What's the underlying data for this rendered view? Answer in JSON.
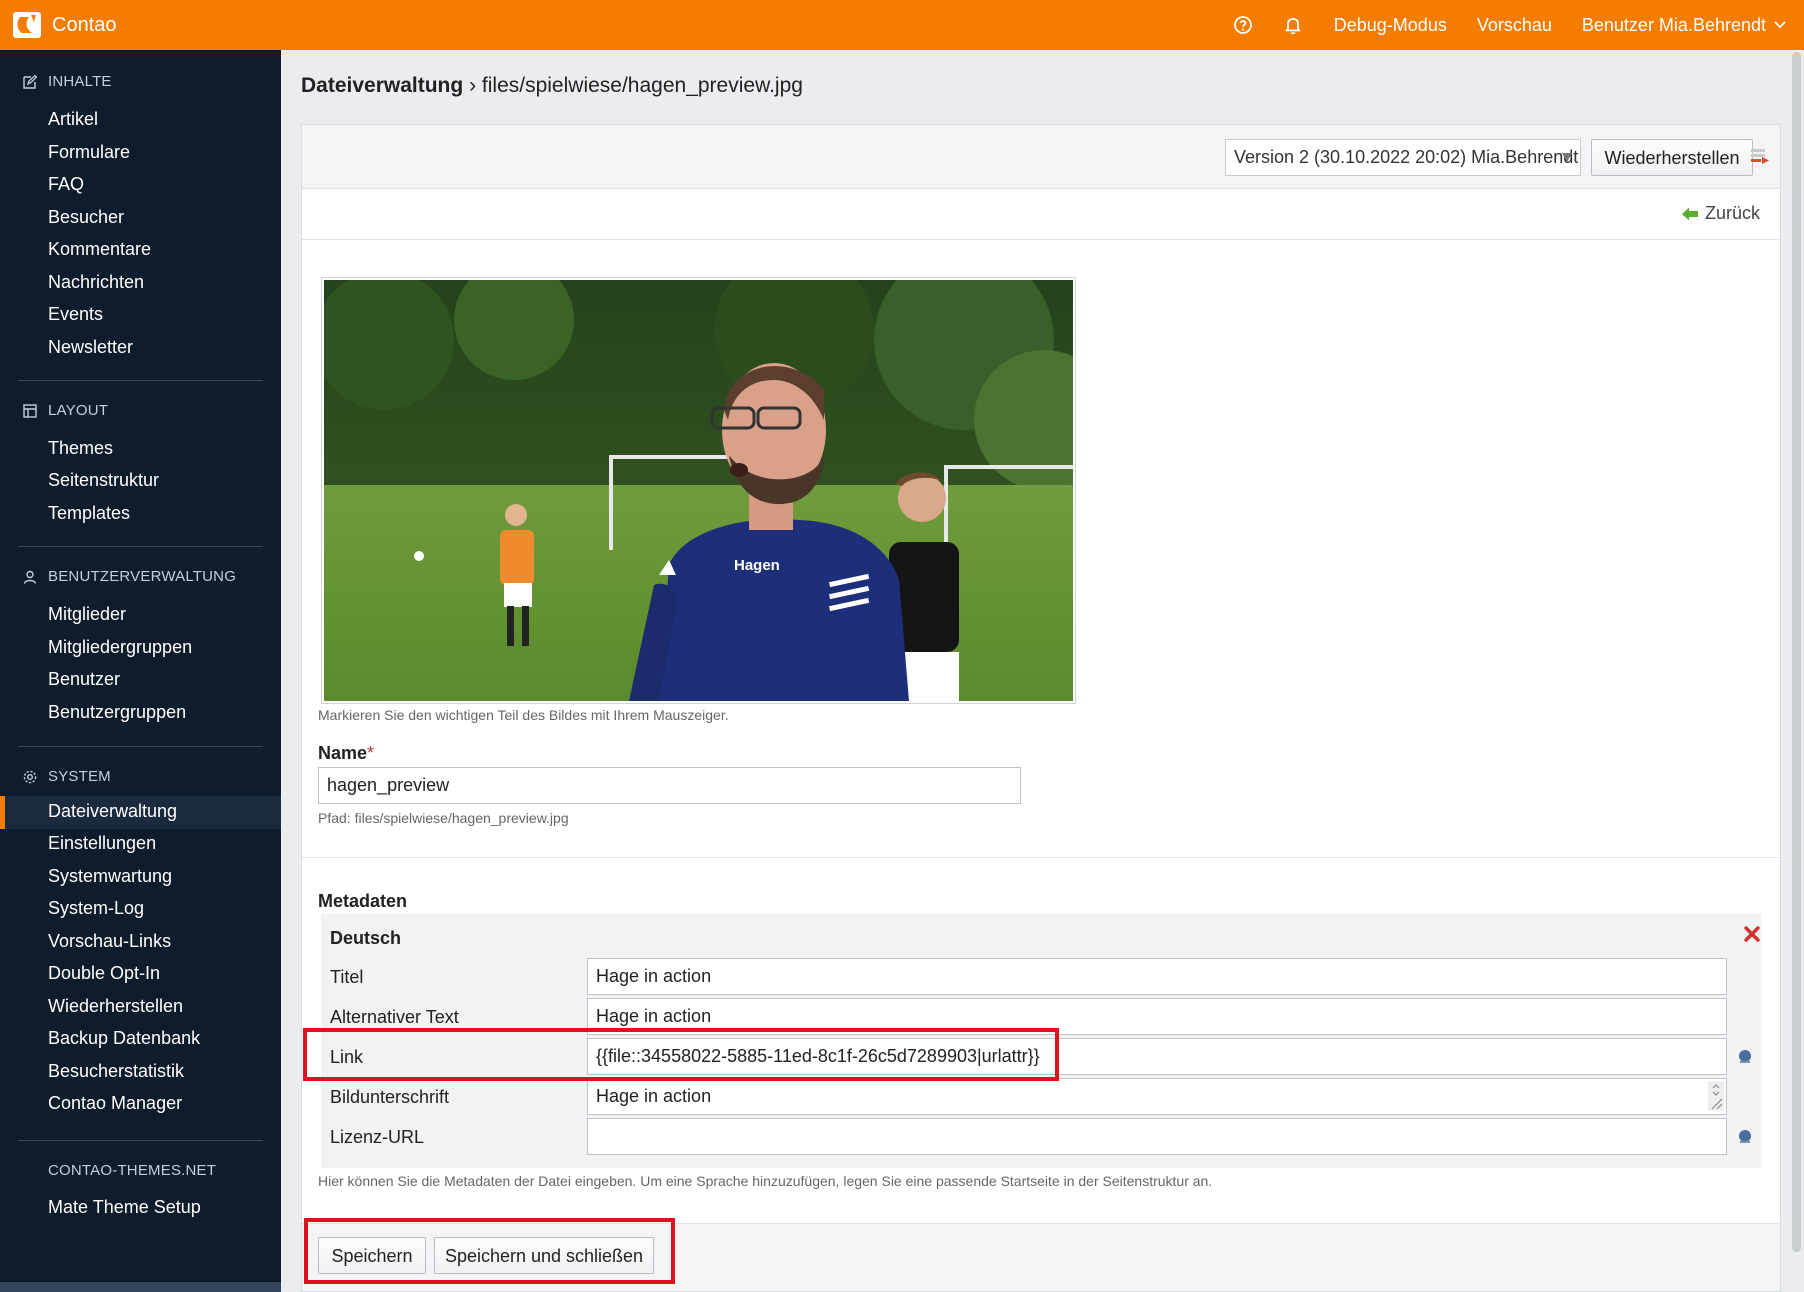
{
  "header": {
    "brand": "Contao",
    "debug": "Debug-Modus",
    "preview": "Vorschau",
    "user": "Benutzer Mia.Behrendt"
  },
  "sidebar": {
    "groups": [
      {
        "title": "INHALTE",
        "items": [
          "Artikel",
          "Formulare",
          "FAQ",
          "Besucher",
          "Kommentare",
          "Nachrichten",
          "Events",
          "Newsletter"
        ]
      },
      {
        "title": "LAYOUT",
        "items": [
          "Themes",
          "Seitenstruktur",
          "Templates"
        ]
      },
      {
        "title": "BENUTZERVERWALTUNG",
        "items": [
          "Mitglieder",
          "Mitgliedergruppen",
          "Benutzer",
          "Benutzergruppen"
        ]
      },
      {
        "title": "SYSTEM",
        "items": [
          "Dateiverwaltung",
          "Einstellungen",
          "Systemwartung",
          "System-Log",
          "Vorschau-Links",
          "Double Opt-In",
          "Wiederherstellen",
          "Backup Datenbank",
          "Besucherstatistik",
          "Contao Manager"
        ]
      },
      {
        "title": "CONTAO-THEMES.NET",
        "items": [
          "Mate Theme Setup"
        ]
      }
    ],
    "active_item": "Dateiverwaltung"
  },
  "breadcrumb": {
    "section": "Dateiverwaltung",
    "separator": "›",
    "path": "files/spielwiese/hagen_preview.jpg"
  },
  "version": {
    "selected": "Version 2 (30.10.2022 20:02) Mia.Behrendt",
    "restore_button": "Wiederherstellen"
  },
  "back_link": "Zurück",
  "image": {
    "shirt_text": "Hagen",
    "hint": "Markieren Sie den wichtigen Teil des Bildes mit Ihrem Mauszeiger."
  },
  "name_field": {
    "label": "Name",
    "required_mark": "*",
    "value": "hagen_preview",
    "path_hint": "Pfad: files/spielwiese/hagen_preview.jpg"
  },
  "metadata": {
    "heading": "Metadaten",
    "language": "Deutsch",
    "fields": {
      "title": {
        "label": "Titel",
        "value": "Hage in action"
      },
      "alt": {
        "label": "Alternativer Text",
        "value": "Hage in action"
      },
      "link": {
        "label": "Link",
        "value": "{{file::34558022-5885-11ed-8c1f-26c5d7289903|urlattr}}"
      },
      "caption": {
        "label": "Bildunterschrift",
        "value": "Hage in action"
      },
      "license": {
        "label": "Lizenz-URL",
        "value": ""
      }
    },
    "hint": "Hier können Sie die Metadaten der Datei eingeben. Um eine Sprache hinzuzufügen, legen Sie eine passende Startseite in der Seitenstruktur an."
  },
  "buttons": {
    "save": "Speichern",
    "save_close": "Speichern und schließen"
  },
  "colors": {
    "header": "#f47c00",
    "sidebar": "#0f1c2c",
    "highlight": "#e0101c"
  }
}
